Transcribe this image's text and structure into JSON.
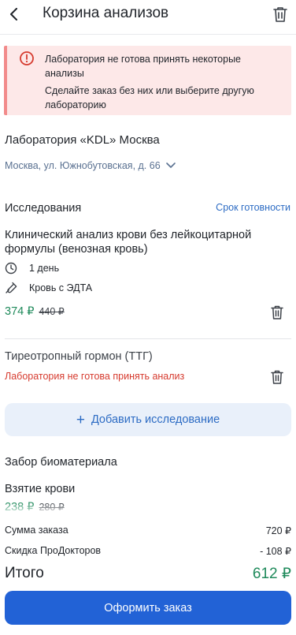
{
  "header": {
    "title": "Корзина анализов",
    "back_icon": "chevron-left-icon",
    "delete_icon": "trash-icon"
  },
  "alert": {
    "icon": "alert-circle-icon",
    "title": "Лаборатория не готова принять некоторые анализы",
    "text": "Сделайте заказ без них или выберите другую лабораторию"
  },
  "lab": {
    "name": "Лаборатория «KDL» Москва",
    "address": "Москва, ул. Южнобутовская, д. 66"
  },
  "studies": {
    "section_title": "Исследования",
    "deadline_link": "Срок готовности",
    "items": [
      {
        "name": "Клинический анализ крови без лейкоцитарной формулы (венозная кровь)",
        "duration": "1 день",
        "sample": "Кровь с ЭДТА",
        "price": "374 ₽",
        "old_price": "440 ₽"
      },
      {
        "name": "Тиреотропный гормон (ТТГ)",
        "error": "Лаборатория не готова принять анализ"
      }
    ],
    "add_button": "Добавить исследование"
  },
  "sampling": {
    "section_title": "Забор биоматериала",
    "item_name": "Взятие крови",
    "price": "238 ₽",
    "old_price": "280 ₽"
  },
  "summary": {
    "order_sum_label": "Сумма заказа",
    "order_sum_value": "720 ₽",
    "discount_label": "Скидка ПроДокторов",
    "discount_value": "- 108 ₽",
    "total_label": "Итого",
    "total_value": "612 ₽"
  },
  "checkout": {
    "label": "Оформить заказ"
  },
  "colors": {
    "accent": "#2262d6",
    "link": "#2d6cc4",
    "price_green": "#1f8a5b",
    "error_red": "#d63b2f",
    "alert_bg": "#fde8e8"
  }
}
